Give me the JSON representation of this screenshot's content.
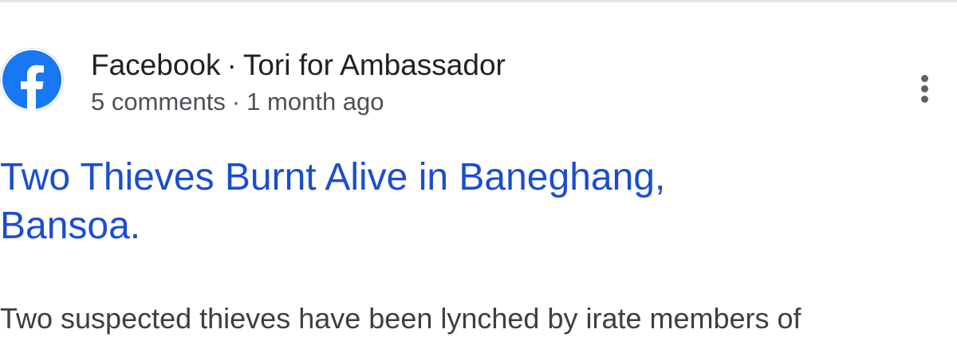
{
  "result": {
    "source": {
      "site": "Facebook",
      "separator": "·",
      "page": "Tori for Ambassador",
      "comments": "5 comments",
      "time_ago": "1 month ago",
      "icon": "facebook-icon"
    },
    "more_icon": "more-vert-icon",
    "title_line1": "Two Thieves Burnt Alive in Baneghang,",
    "title_line2": "Bansoa.",
    "snippet": "Two suspected thieves have been lynched by irate members of"
  },
  "colors": {
    "link": "#1a4ed0",
    "facebook_blue": "#1877f2",
    "text_primary": "#202124",
    "text_secondary": "#4d5156"
  }
}
